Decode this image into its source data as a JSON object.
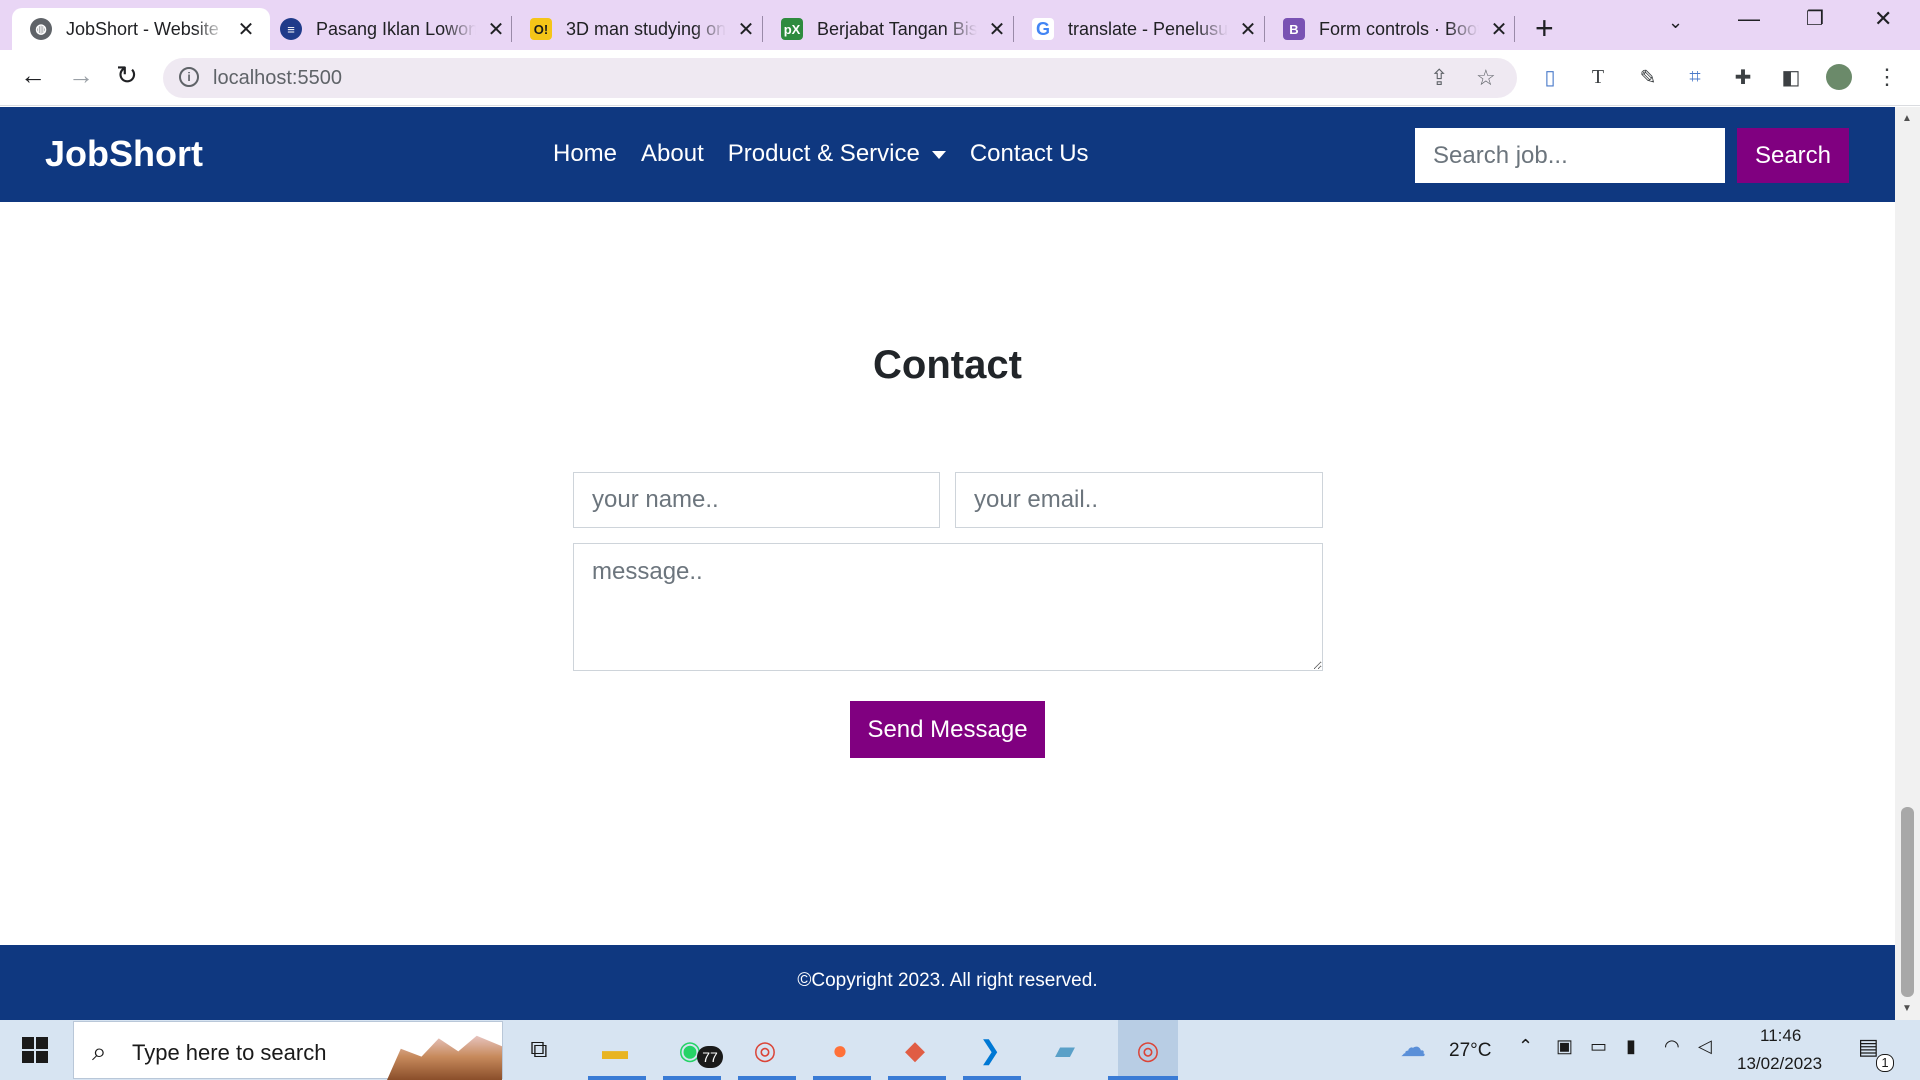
{
  "browser": {
    "tabs": [
      {
        "title": "JobShort - Website",
        "active": true,
        "icon": "globe-icon"
      },
      {
        "title": "Pasang Iklan Lowongan",
        "active": false,
        "icon": "site-icon"
      },
      {
        "title": "3D man studying on",
        "active": false,
        "icon": "o-icon"
      },
      {
        "title": "Berjabat Tangan Bisnis",
        "active": false,
        "icon": "px-icon"
      },
      {
        "title": "translate - Penelusuran",
        "active": false,
        "icon": "google-icon"
      },
      {
        "title": "Form controls · Bootstrap",
        "active": false,
        "icon": "bootstrap-icon"
      }
    ],
    "address": "localhost:5500",
    "favicon_glyphs": {
      "o": "O!",
      "px": "pX",
      "google": "G",
      "bootstrap": "B"
    },
    "colors": {
      "tabstrip": "#e9d6f5",
      "accent": "#800080"
    }
  },
  "site": {
    "brand": "JobShort",
    "nav": {
      "home": "Home",
      "about": "About",
      "products": "Product & Service",
      "contact": "Contact Us"
    },
    "search": {
      "placeholder": "Search job...",
      "button": "Search"
    },
    "colors": {
      "navbar": "#0f3880",
      "button": "#800080"
    }
  },
  "contact": {
    "title": "Contact",
    "name_placeholder": "your name..",
    "email_placeholder": "your email..",
    "message_placeholder": "message..",
    "send_label": "Send Message"
  },
  "footer": {
    "text": "©Copyright 2023. All right reserved."
  },
  "taskbar": {
    "search_placeholder": "Type here to search",
    "whatsapp_badge": "77",
    "weather": "27°C",
    "time": "11:46",
    "date": "13/02/2023",
    "notifications": "1"
  }
}
